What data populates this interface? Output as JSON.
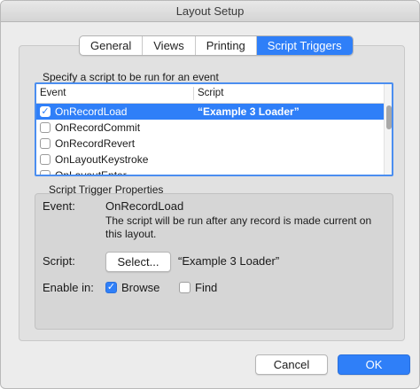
{
  "window": {
    "title": "Layout Setup"
  },
  "tabs": [
    {
      "label": "General"
    },
    {
      "label": "Views"
    },
    {
      "label": "Printing"
    },
    {
      "label": "Script Triggers"
    }
  ],
  "list": {
    "heading": "Specify a script to be run for an event",
    "columns": {
      "event": "Event",
      "script": "Script"
    },
    "rows": [
      {
        "event": "OnRecordLoad",
        "script": "“Example 3 Loader”",
        "checked": true,
        "selected": true
      },
      {
        "event": "OnRecordCommit",
        "script": "",
        "checked": false
      },
      {
        "event": "OnRecordRevert",
        "script": "",
        "checked": false
      },
      {
        "event": "OnLayoutKeystroke",
        "script": "",
        "checked": false
      },
      {
        "event": "OnLayoutEnter",
        "script": "",
        "checked": false
      }
    ],
    "check_glyph": "✓"
  },
  "properties": {
    "heading": "Script Trigger Properties",
    "event_label": "Event:",
    "event_value": "OnRecordLoad",
    "description_line1": "The script will be run after any record is made current on",
    "description_line2": "this layout.",
    "script_label": "Script:",
    "select_button": "Select...",
    "script_value": "“Example 3 Loader”",
    "enable_label": "Enable in:",
    "browse_label": "Browse",
    "browse_checked": true,
    "find_label": "Find",
    "find_checked": false
  },
  "buttons": {
    "cancel": "Cancel",
    "ok": "OK"
  },
  "colors": {
    "accent": "#2f7ff8"
  }
}
